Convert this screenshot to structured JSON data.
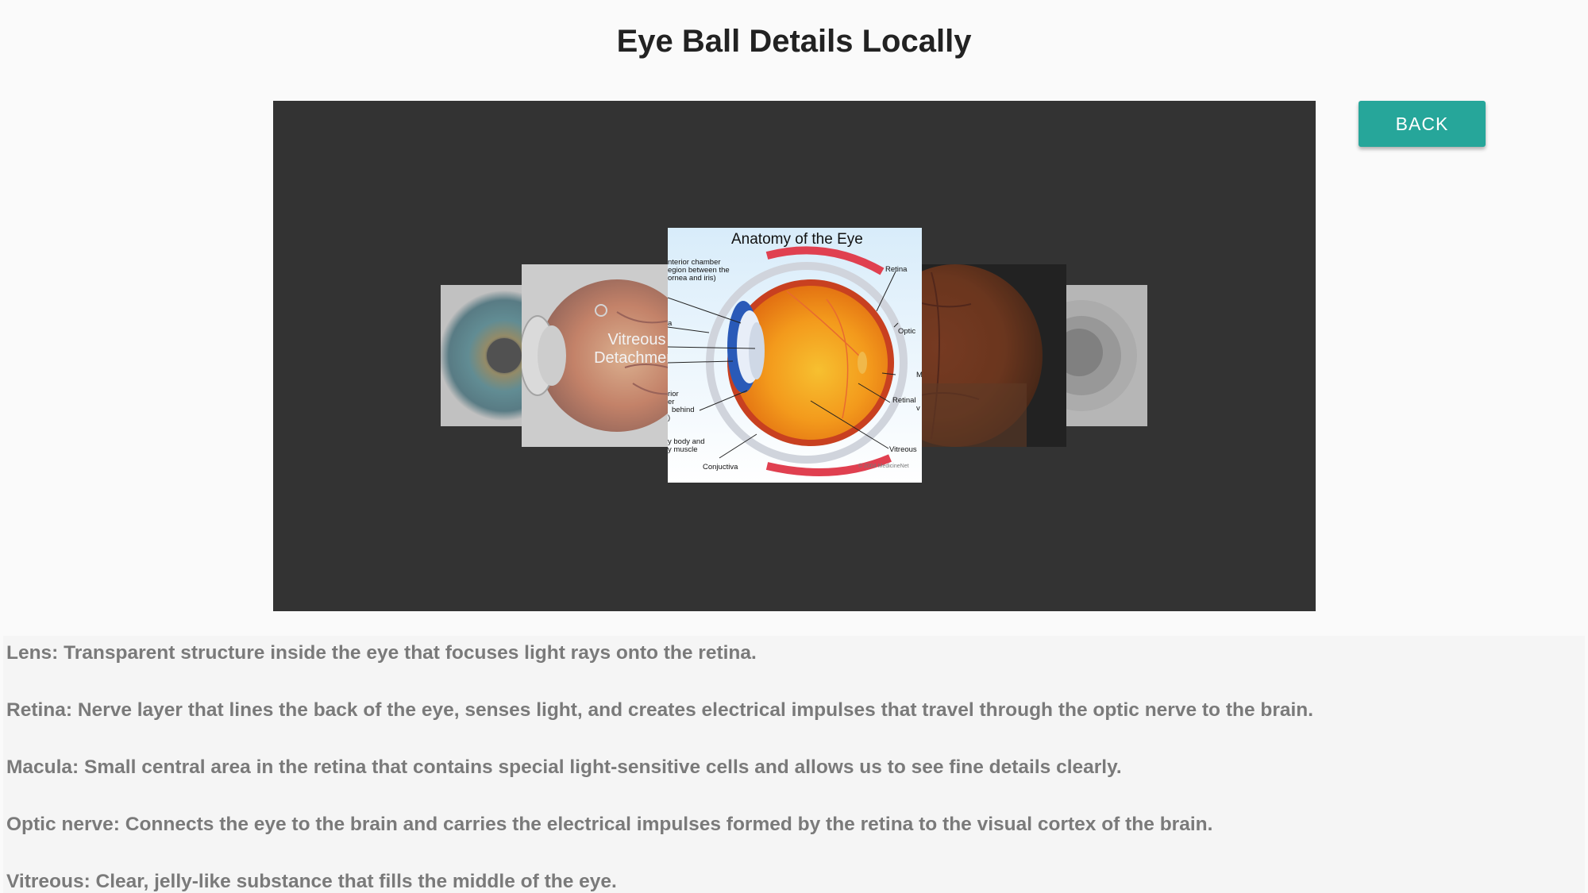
{
  "page": {
    "title": "Eye Ball Details Locally"
  },
  "toolbar": {
    "back_label": "BACK"
  },
  "carousel": {
    "items": [
      {
        "name": "iris-closeup",
        "label": ""
      },
      {
        "name": "vitreous-detachment",
        "label_line1": "Vitreous",
        "label_line2": "Detachment"
      },
      {
        "name": "anatomy-of-the-eye",
        "title": "Anatomy of the Eye",
        "labels": {
          "anterior1": "nterior chamber",
          "anterior2": "egion between the",
          "anterior3": "ornea and iris)",
          "retina": "Retina",
          "optic": "Optic",
          "m": "M",
          "retinal": "Retinal",
          "v": "v",
          "behind1": "rior",
          "behind2": "er",
          "behind3": "behind",
          "behind4": ")",
          "ciliary1": "y body and",
          "ciliary2": "y muscle",
          "vitreous": "Vitreous",
          "conjuctiva": "Conjuctiva",
          "a": "a",
          "copyright": "© 2004 MedicineNet"
        }
      },
      {
        "name": "retina-fundus",
        "label": ""
      },
      {
        "name": "grey-eye",
        "label": ""
      }
    ]
  },
  "descriptions": [
    "Lens: Transparent structure inside the eye that focuses light rays onto the retina.",
    "Retina: Nerve layer that lines the back of the eye, senses light, and creates electrical impulses that travel through the optic nerve to the brain.",
    "Macula: Small central area in the retina that contains special light-sensitive cells and allows us to see fine details clearly.",
    "Optic nerve: Connects the eye to the brain and carries the electrical impulses formed by the retina to the visual cortex of the brain.",
    "Vitreous: Clear, jelly-like substance that fills the middle of the eye."
  ],
  "colors": {
    "accent": "#26a69a",
    "viewer_bg": "#333333",
    "desc_text": "#7a7a7a"
  }
}
